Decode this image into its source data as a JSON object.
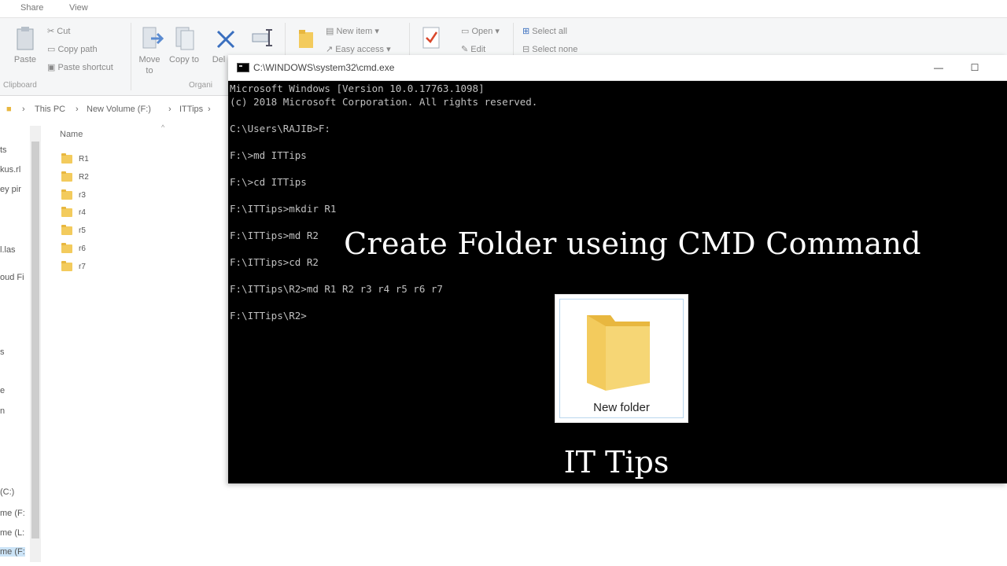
{
  "explorer": {
    "tabs": [
      "Share",
      "View"
    ],
    "ribbon": {
      "clipboard": {
        "paste": "Paste",
        "cut": "Cut",
        "copy_path": "Copy path",
        "paste_shortcut": "Paste shortcut",
        "group_label": "Clipboard"
      },
      "organize": {
        "move_to": "Move to",
        "copy_to": "Copy to",
        "delete": "Del",
        "group_label": "Organi"
      },
      "new": {
        "new_item": "New item",
        "easy_access": "Easy access"
      },
      "open": {
        "open": "Open",
        "edit": "Edit"
      },
      "select": {
        "select_all": "Select all",
        "select_none": "Select none"
      }
    },
    "breadcrumb": [
      "This PC",
      "New Volume (F:)",
      "ITTips"
    ],
    "column_header": "Name",
    "files": [
      "R1",
      "R2",
      "r3",
      "r4",
      "r5",
      "r6",
      "r7"
    ],
    "nav_items": [
      "ts",
      "kus.rl",
      "ey pir",
      "l.las",
      "oud Fi",
      "s",
      "e",
      "n",
      "(C:)",
      "me (F:",
      "me (L:",
      "me (F:"
    ]
  },
  "cmd": {
    "title": "C:\\WINDOWS\\system32\\cmd.exe",
    "controls": {
      "minimize": "—",
      "maximize": "☐"
    },
    "lines": [
      "Microsoft Windows [Version 10.0.17763.1098]",
      "(c) 2018 Microsoft Corporation. All rights reserved.",
      "",
      "C:\\Users\\RAJIB>F:",
      "",
      "F:\\>md ITTips",
      "",
      "F:\\>cd ITTips",
      "",
      "F:\\ITTips>mkdir R1",
      "",
      "F:\\ITTips>md R2",
      "",
      "F:\\ITTips>cd R2",
      "",
      "F:\\ITTips\\R2>md R1 R2 r3 r4 r5 r6 r7",
      "",
      "F:\\ITTips\\R2>"
    ]
  },
  "overlay": {
    "headline": "Create Folder useing CMD Command",
    "folder_caption": "New folder",
    "brand": "IT Tips"
  },
  "colors": {
    "folder": "#f3cb5d",
    "cmd_background": "#000000",
    "cmd_text": "#c0c0c0"
  }
}
